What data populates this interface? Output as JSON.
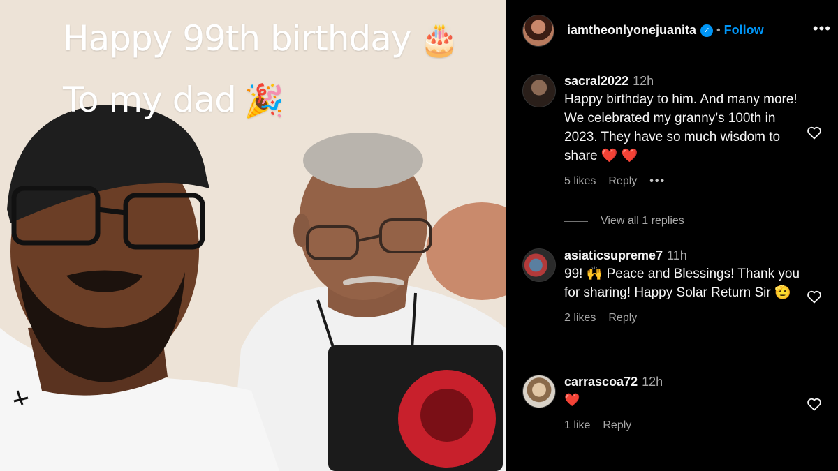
{
  "story": {
    "line1": "Happy 99th birthday",
    "line1_emoji": "🎂",
    "line2": "To my dad",
    "line2_emoji": "🎉"
  },
  "post": {
    "username": "iamtheonlyonejuanita",
    "separator": "•",
    "follow_label": "Follow",
    "more_icon": "more-horizontal-icon",
    "verified_icon": "verified-badge-icon"
  },
  "comments": [
    {
      "username": "sacral2022",
      "time": "12h",
      "text": "Happy birthday to him. And many more! We celebrated my granny’s 100th in 2023. They have so much wisdom to share ❤️ ❤️",
      "likes": "5 likes",
      "reply": "Reply",
      "more": "•••",
      "view_replies": "View all 1 replies"
    },
    {
      "username": "asiaticsupreme7",
      "time": "11h",
      "text": "99! 🙌 Peace and Blessings! Thank you for sharing! Happy Solar Return Sir 🫡",
      "likes": "2 likes",
      "reply": "Reply"
    },
    {
      "username": "carrascoa72",
      "time": "12h",
      "text": "❤️",
      "likes": "1 like",
      "reply": "Reply"
    }
  ],
  "colors": {
    "background": "#000000",
    "link_blue": "#0095f6",
    "muted_text": "#a8a8a8",
    "heart_red": "#ff2d3f"
  }
}
